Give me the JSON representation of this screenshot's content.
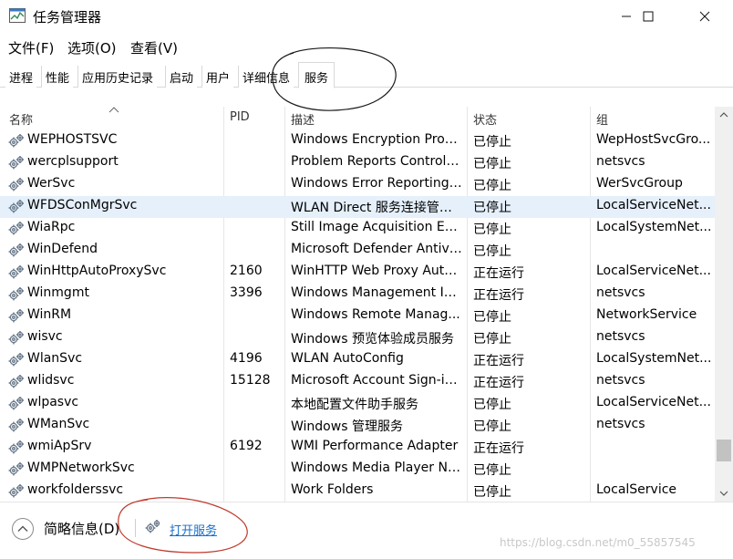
{
  "window": {
    "title": "任务管理器",
    "minimize_glyph": "—",
    "maximize_glyph": "☐",
    "close_glyph": "✕"
  },
  "menu": [
    {
      "label": "文件(F)"
    },
    {
      "label": "选项(O)"
    },
    {
      "label": "查看(V)"
    }
  ],
  "tabs": [
    {
      "label": "进程"
    },
    {
      "label": "性能"
    },
    {
      "label": "应用历史记录"
    },
    {
      "label": "启动"
    },
    {
      "label": "用户"
    },
    {
      "label": "详细信息"
    },
    {
      "label": "服务",
      "active": true
    }
  ],
  "columns": {
    "name": "名称",
    "pid": "PID",
    "desc": "描述",
    "status": "状态",
    "group": "组"
  },
  "services": [
    {
      "name": "WEPHOSTSVC",
      "pid": "",
      "desc": "Windows Encryption Provi...",
      "status": "已停止",
      "group": "WepHostSvcGro..."
    },
    {
      "name": "wercplsupport",
      "pid": "",
      "desc": "Problem Reports Control ...",
      "status": "已停止",
      "group": "netsvcs"
    },
    {
      "name": "WerSvc",
      "pid": "",
      "desc": "Windows Error Reporting ...",
      "status": "已停止",
      "group": "WerSvcGroup"
    },
    {
      "name": "WFDSConMgrSvc",
      "pid": "",
      "desc": "WLAN Direct 服务连接管理...",
      "status": "已停止",
      "group": "LocalServiceNet...",
      "selected": true
    },
    {
      "name": "WiaRpc",
      "pid": "",
      "desc": "Still Image Acquisition Ev...",
      "status": "已停止",
      "group": "LocalSystemNet..."
    },
    {
      "name": "WinDefend",
      "pid": "",
      "desc": "Microsoft Defender Antivi...",
      "status": "已停止",
      "group": ""
    },
    {
      "name": "WinHttpAutoProxySvc",
      "pid": "2160",
      "desc": "WinHTTP Web Proxy Auto...",
      "status": "正在运行",
      "group": "LocalServiceNet..."
    },
    {
      "name": "Winmgmt",
      "pid": "3396",
      "desc": "Windows Management In...",
      "status": "正在运行",
      "group": "netsvcs"
    },
    {
      "name": "WinRM",
      "pid": "",
      "desc": "Windows Remote Manag...",
      "status": "已停止",
      "group": "NetworkService"
    },
    {
      "name": "wisvc",
      "pid": "",
      "desc": "Windows 预览体验成员服务",
      "status": "已停止",
      "group": "netsvcs"
    },
    {
      "name": "WlanSvc",
      "pid": "4196",
      "desc": "WLAN AutoConfig",
      "status": "正在运行",
      "group": "LocalSystemNet..."
    },
    {
      "name": "wlidsvc",
      "pid": "15128",
      "desc": "Microsoft Account Sign-in...",
      "status": "正在运行",
      "group": "netsvcs"
    },
    {
      "name": "wlpasvc",
      "pid": "",
      "desc": "本地配置文件助手服务",
      "status": "已停止",
      "group": "LocalServiceNet..."
    },
    {
      "name": "WManSvc",
      "pid": "",
      "desc": "Windows 管理服务",
      "status": "已停止",
      "group": "netsvcs"
    },
    {
      "name": "wmiApSrv",
      "pid": "6192",
      "desc": "WMI Performance Adapter",
      "status": "正在运行",
      "group": ""
    },
    {
      "name": "WMPNetworkSvc",
      "pid": "",
      "desc": "Windows Media Player Ne...",
      "status": "已停止",
      "group": ""
    },
    {
      "name": "workfolderssvc",
      "pid": "",
      "desc": "Work Folders",
      "status": "已停止",
      "group": "LocalService"
    }
  ],
  "statusbar": {
    "fewer_details": "简略信息(D)",
    "open_services": "打开服务",
    "watermark": "https://blog.csdn.net/m0_55857545"
  },
  "colors": {
    "selection": "#e5f0fb",
    "link": "#1a6fc9",
    "annotation": "#c0392b"
  }
}
